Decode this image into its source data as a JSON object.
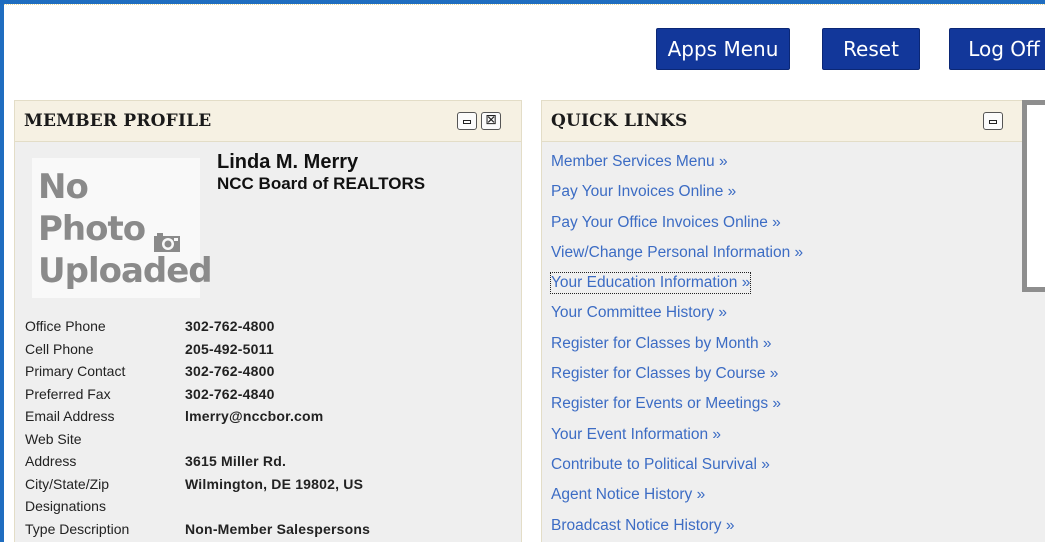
{
  "toolbar": {
    "apps_menu_label": "Apps Menu",
    "reset_label": "Reset",
    "log_off_label": "Log Off"
  },
  "member_profile": {
    "title": "MEMBER PROFILE",
    "photo_placeholder": [
      "No",
      "Photo",
      "Uploaded"
    ],
    "name": "Linda M. Merry",
    "organization": "NCC Board of REALTORS",
    "fields": [
      {
        "label": "Office Phone",
        "value": "302-762-4800"
      },
      {
        "label": "Cell Phone",
        "value": "205-492-5011"
      },
      {
        "label": "Primary Contact",
        "value": "302-762-4800"
      },
      {
        "label": "Preferred Fax",
        "value": "302-762-4840"
      },
      {
        "label": "Email Address",
        "value": "lmerry@nccbor.com"
      },
      {
        "label": "Web Site",
        "value": ""
      },
      {
        "label": "Address",
        "value": "3615 Miller Rd."
      },
      {
        "label": "City/State/Zip",
        "value": "Wilmington, DE 19802, US"
      },
      {
        "label": "Designations",
        "value": ""
      },
      {
        "label": "Type Description",
        "value": "Non-Member Salespersons"
      }
    ]
  },
  "quick_links": {
    "title": "QUICK LINKS",
    "items": [
      {
        "label": "Member Services Menu »"
      },
      {
        "label": "Pay Your Invoices Online »"
      },
      {
        "label": "Pay Your Office Invoices Online »"
      },
      {
        "label": "View/Change Personal Information »"
      },
      {
        "label": "Your Education Information »"
      },
      {
        "label": "Your Committee History »"
      },
      {
        "label": "Register for Classes by Month »"
      },
      {
        "label": "Register for Classes by Course »"
      },
      {
        "label": "Register for Events or Meetings »"
      },
      {
        "label": "Your Event Information »"
      },
      {
        "label": "Contribute to Political Survival »"
      },
      {
        "label": "Agent Notice History »"
      },
      {
        "label": "Broadcast Notice History »"
      }
    ]
  },
  "colors": {
    "frame_blue": "#1f6dc0",
    "button_navy": "#12379a",
    "link_blue": "#3c6cc4",
    "panel_header_beige": "#f6f1e3"
  }
}
